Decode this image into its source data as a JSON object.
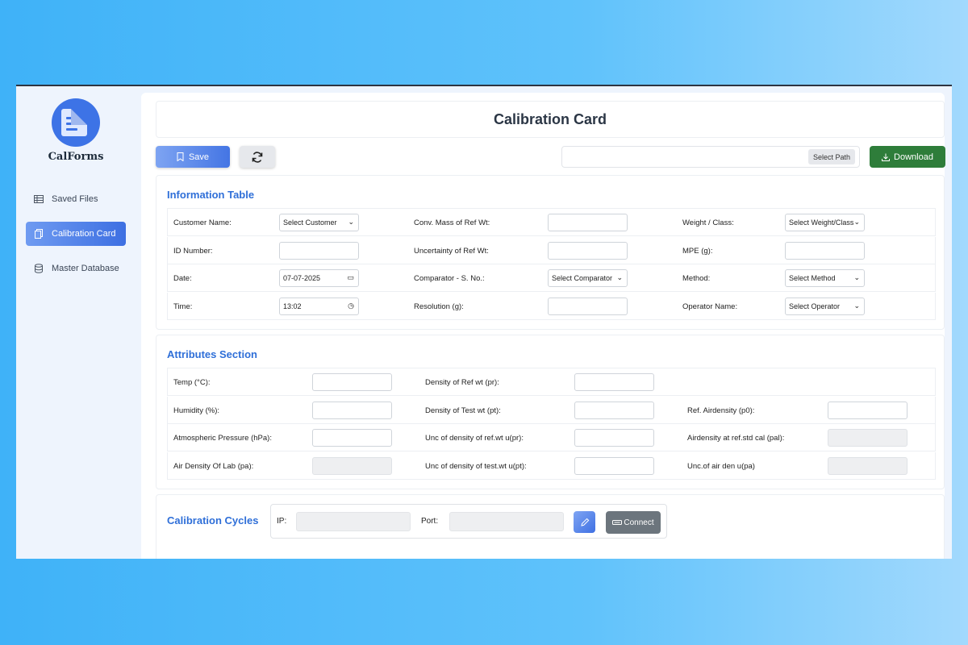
{
  "app": {
    "brand": "CalForms"
  },
  "sidebar": {
    "items": [
      {
        "label": "Saved Files",
        "icon": "table-icon"
      },
      {
        "label": "Calibration Card",
        "icon": "copy-icon",
        "active": true
      },
      {
        "label": "Master Database",
        "icon": "database-icon"
      }
    ]
  },
  "page": {
    "title": "Calibration Card"
  },
  "toolbar": {
    "save_label": "Save",
    "select_path_label": "Select Path",
    "download_label": "Download",
    "path_value": ""
  },
  "info": {
    "title": "Information Table",
    "rows": [
      [
        {
          "label": "Customer Name:",
          "value": "Select Customer",
          "type": "select"
        },
        {
          "label": "Conv. Mass of Ref Wt:",
          "value": "",
          "type": "input"
        },
        {
          "label": "Weight / Class:",
          "value": "Select Weight/Class",
          "type": "select"
        }
      ],
      [
        {
          "label": "ID Number:",
          "value": "",
          "type": "input"
        },
        {
          "label": "Uncertainty of Ref Wt:",
          "value": "",
          "type": "input"
        },
        {
          "label": "MPE (g):",
          "value": "",
          "type": "input"
        }
      ],
      [
        {
          "label": "Date:",
          "value": "07-07-2025",
          "type": "date"
        },
        {
          "label": "Comparator - S. No.:",
          "value": "Select Comparator",
          "type": "select"
        },
        {
          "label": "Method:",
          "value": "Select Method",
          "type": "select"
        }
      ],
      [
        {
          "label": "Time:",
          "value": "13:02",
          "type": "time"
        },
        {
          "label": "Resolution (g):",
          "value": "",
          "type": "input"
        },
        {
          "label": "Operator Name:",
          "value": "Select Operator",
          "type": "select"
        }
      ]
    ]
  },
  "attributes": {
    "title": "Attributes Section",
    "rows": [
      [
        {
          "label": "Temp (°C):",
          "value": "",
          "disabled": false
        },
        {
          "label": "Density of Ref wt (pr):",
          "value": "",
          "disabled": false
        },
        null
      ],
      [
        {
          "label": "Humidity (%):",
          "value": "",
          "disabled": false
        },
        {
          "label": "Density of Test wt (pt):",
          "value": "",
          "disabled": false
        },
        {
          "label": "Ref. Airdensity (p0):",
          "value": "",
          "disabled": false
        }
      ],
      [
        {
          "label": "Atmospheric Pressure (hPa):",
          "value": "",
          "disabled": false
        },
        {
          "label": "Unc of density of ref.wt u(pr):",
          "value": "",
          "disabled": false
        },
        {
          "label": "Airdensity at ref.std cal (pal):",
          "value": "",
          "disabled": true
        }
      ],
      [
        {
          "label": "Air Density Of Lab (pa):",
          "value": "",
          "disabled": true
        },
        {
          "label": "Unc of density of test.wt u(pt):",
          "value": "",
          "disabled": false
        },
        {
          "label": "Unc.of air den u(pa)",
          "value": "",
          "disabled": true
        }
      ]
    ]
  },
  "cycles": {
    "title": "Calibration Cycles",
    "ip_label": "IP:",
    "port_label": "Port:",
    "ip_value": "",
    "port_value": "",
    "connect_label": "Connect"
  },
  "colors": {
    "accent": "#3d6fe2",
    "section_title": "#2f6fd8",
    "download": "#2e7d3a",
    "connect": "#6c757d"
  }
}
